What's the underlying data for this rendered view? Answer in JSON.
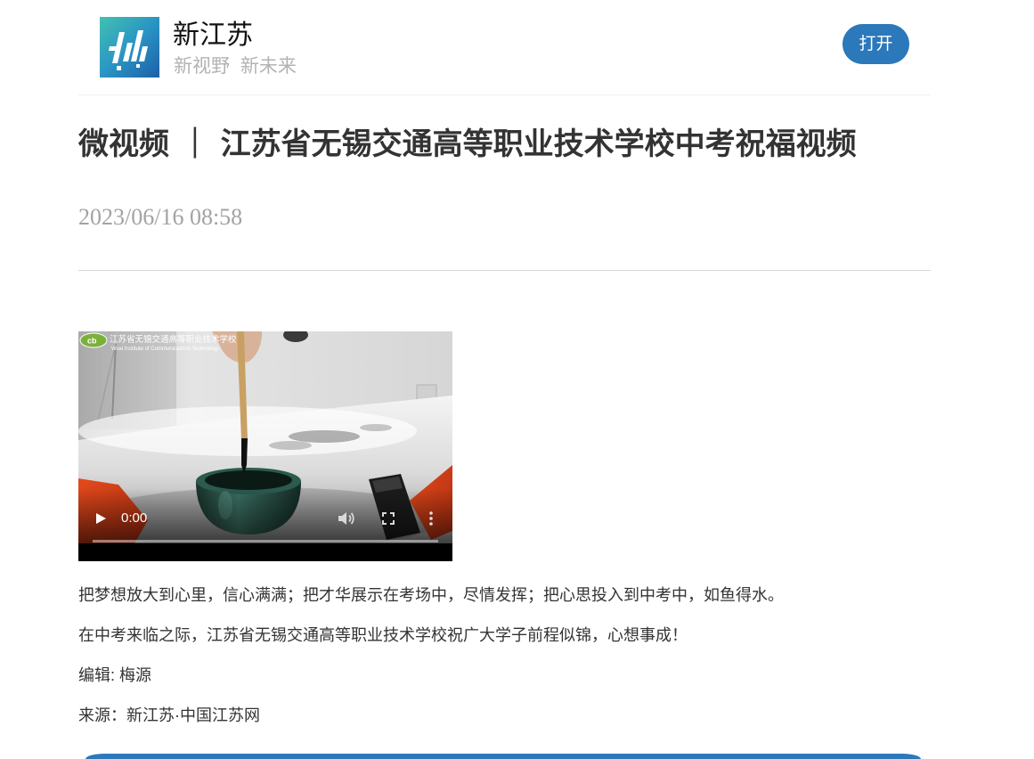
{
  "header": {
    "app_name": "新江苏",
    "tagline": "新视野 新未来",
    "open_button_label": "打开",
    "logo_icon": "xinjiangsu-logo-icon"
  },
  "article": {
    "title": "微视频 ｜ 江苏省无锡交通高等职业技术学校中考祝福视频",
    "publish_time": "2023/06/16 08:58",
    "video": {
      "watermark_cn": "江苏省无锡交通高等职业技术学校",
      "watermark_en": "Wuxi Institute of Communications Technology",
      "current_time": "0:00",
      "progress": 0,
      "controls": {
        "play": "play-icon",
        "volume": "volume-icon",
        "fullscreen": "fullscreen-icon",
        "more": "more-vertical-icon"
      }
    },
    "paragraphs": [
      "把梦想放大到心里，信心满满；把才华展示在考场中，尽情发挥；把心思投入到中考中，如鱼得水。",
      "在中考来临之际，江苏省无锡交通高等职业技术学校祝广大学子前程似锦，心想事成！"
    ],
    "editor": "编辑: 梅源",
    "source": "来源：新江苏·中国江苏网"
  },
  "colors": {
    "accent": "#2b78ba",
    "title_text": "#333333",
    "meta_text": "#a3a3a3",
    "tagline_text": "#b3b3b3",
    "body_text": "#333333"
  }
}
